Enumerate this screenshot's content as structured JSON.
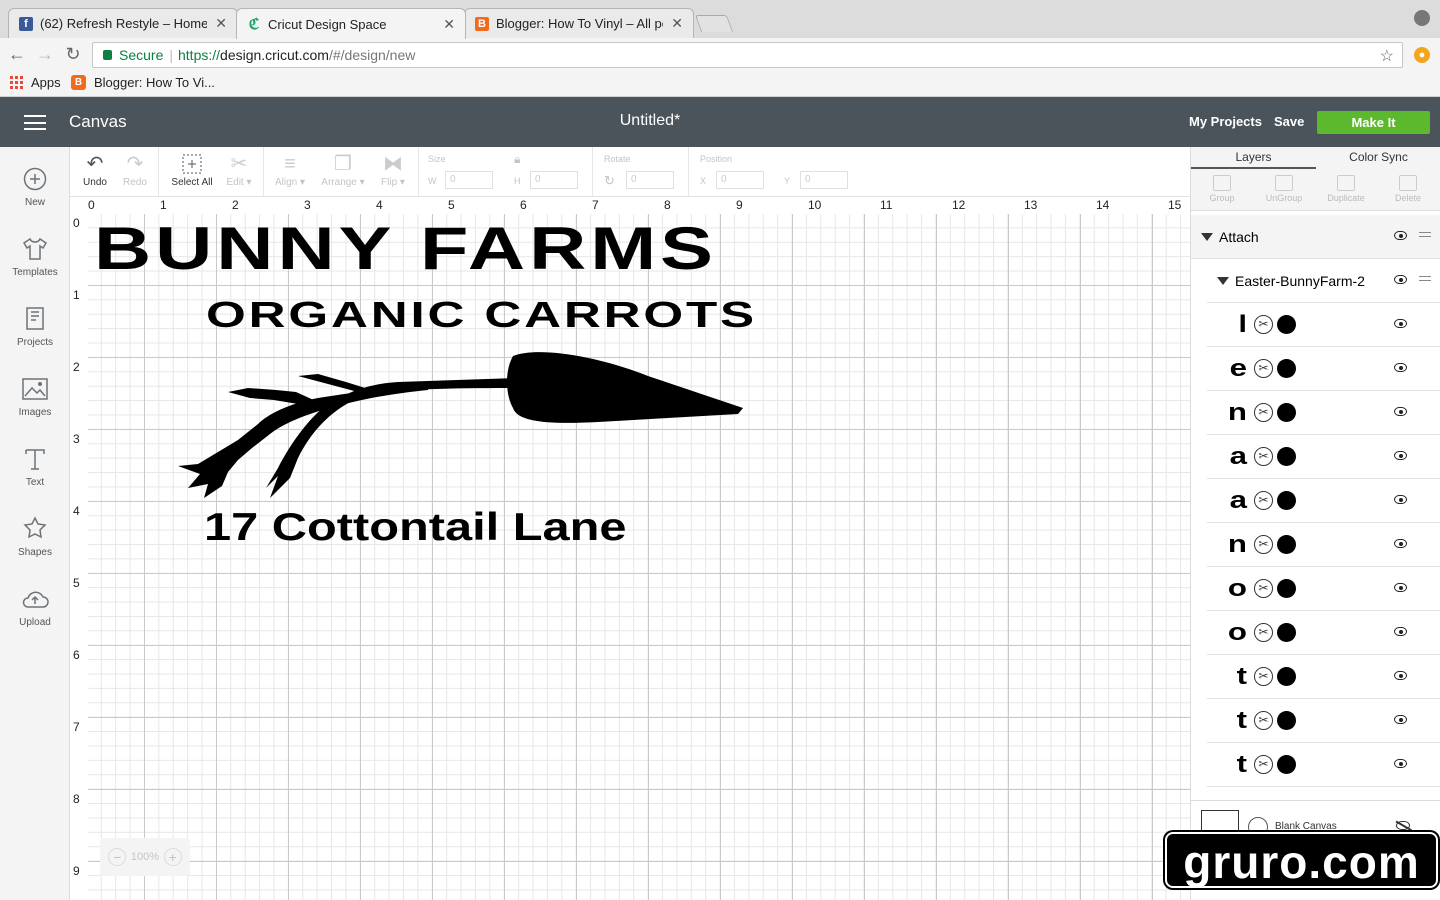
{
  "browser": {
    "tabs": [
      {
        "title": "(62) Refresh Restyle – Home",
        "favicon": "facebook-icon",
        "color": "#3b5998"
      },
      {
        "title": "Cricut Design Space",
        "favicon": "cricut-icon",
        "color": "#1aa56b",
        "active": true
      },
      {
        "title": "Blogger: How To Vinyl – All po",
        "favicon": "blogger-icon",
        "color": "#f26b1d"
      }
    ],
    "secure_label": "Secure",
    "url_scheme": "https://",
    "url_host": "design.cricut.com",
    "url_path": "/#/design/new",
    "bookmarks": [
      {
        "label": "Apps",
        "icon": "apps-grid-icon"
      },
      {
        "label": "Blogger: How To Vi...",
        "icon": "blogger-icon"
      }
    ]
  },
  "app": {
    "section": "Canvas",
    "doc_title": "Untitled*",
    "my_projects": "My Projects",
    "save": "Save",
    "make_it": "Make It",
    "accent": "#5cb82c",
    "header_bg": "#4a545a"
  },
  "sidebar": [
    {
      "label": "New",
      "icon": "plus-circle-icon"
    },
    {
      "label": "Templates",
      "icon": "tshirt-icon"
    },
    {
      "label": "Projects",
      "icon": "projects-icon"
    },
    {
      "label": "Images",
      "icon": "image-icon"
    },
    {
      "label": "Text",
      "icon": "text-icon"
    },
    {
      "label": "Shapes",
      "icon": "shapes-icon"
    },
    {
      "label": "Upload",
      "icon": "upload-cloud-icon"
    }
  ],
  "toolbar": {
    "undo": "Undo",
    "redo": "Redo",
    "select_all": "Select All",
    "edit": "Edit",
    "align": "Align",
    "arrange": "Arrange",
    "flip": "Flip",
    "size_label": "Size",
    "w_label": "W",
    "w_value": "0",
    "h_label": "H",
    "h_value": "0",
    "rotate_label": "Rotate",
    "rotate_value": "0",
    "position_label": "Position",
    "x_label": "X",
    "x_value": "0",
    "y_label": "Y",
    "y_value": "0"
  },
  "ruler": {
    "top": [
      "0",
      "1",
      "2",
      "3",
      "4",
      "5",
      "6",
      "7",
      "8",
      "9",
      "10",
      "11",
      "12",
      "13",
      "14",
      "15"
    ],
    "left": [
      "0",
      "1",
      "2",
      "3",
      "4",
      "5",
      "6",
      "7",
      "8",
      "9"
    ]
  },
  "design": {
    "line1": "BUNNY FARMS",
    "line2": "ORGANIC CARROTS",
    "line3": "17 Cottontail Lane"
  },
  "zoom": "100%",
  "panel": {
    "tabs": [
      "Layers",
      "Color Sync"
    ],
    "tools": [
      "Group",
      "UnGroup",
      "Duplicate",
      "Delete"
    ],
    "attach": "Attach",
    "group_name": "Easter-BunnyFarm-2",
    "layers": [
      "l",
      "e",
      "n",
      "a",
      "a",
      "n",
      "o",
      "o",
      "t",
      "t",
      "t"
    ],
    "blank_canvas": "Blank Canvas"
  },
  "watermark": "gruro.com"
}
